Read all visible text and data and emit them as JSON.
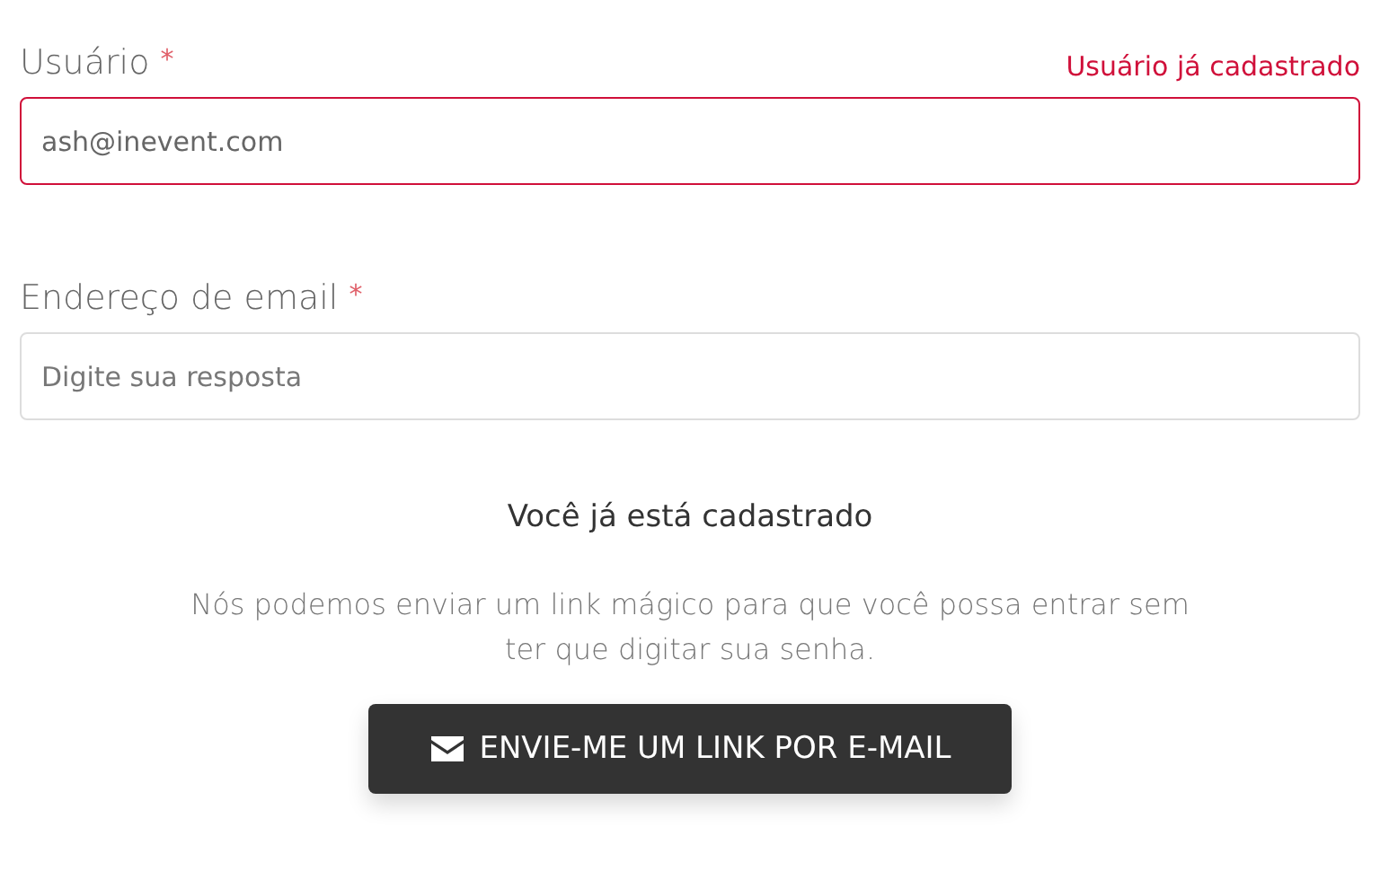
{
  "fields": [
    {
      "label": "Usuário",
      "required_mark": "*",
      "error": "Usuário já cadastrado",
      "value": "ash@inevent.com",
      "invalid": true
    },
    {
      "label": "Endereço de email",
      "required_mark": "*",
      "placeholder": "Digite sua resposta",
      "invalid": false
    }
  ],
  "notice": {
    "title": "Você já está cadastrado",
    "text": "Nós podemos enviar um link mágico para que você possa entrar sem ter que digitar sua senha.",
    "button": "ENVIE-ME UM LINK POR E-MAIL"
  }
}
